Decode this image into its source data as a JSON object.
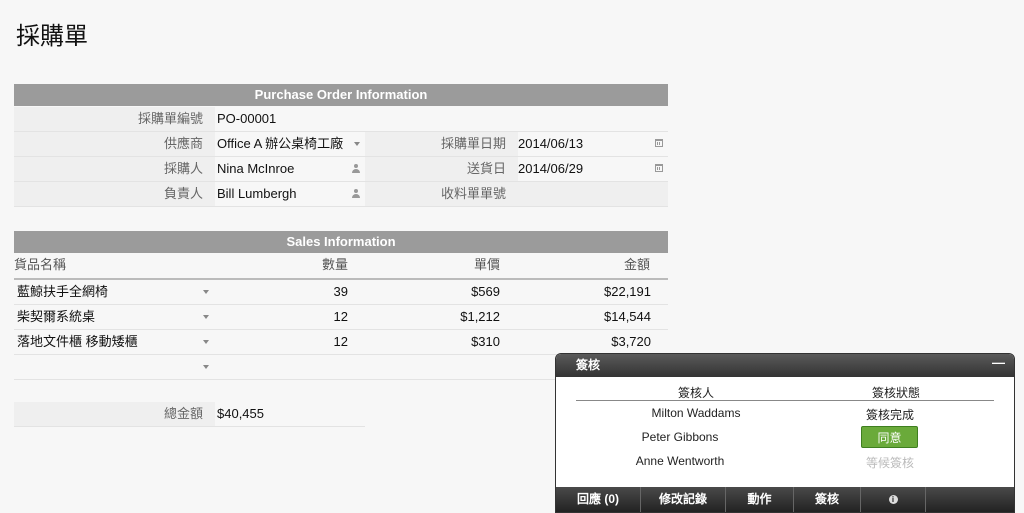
{
  "page": {
    "title": "採購單"
  },
  "purchase_order": {
    "header": "Purchase Order Information",
    "po_number_label": "採購單編號",
    "po_number": "PO-00001",
    "vendor_label": "供應商",
    "vendor": "Office A 辦公桌椅工廠",
    "order_date_label": "採購單日期",
    "order_date": "2014/06/13",
    "buyer_label": "採購人",
    "buyer": "Nina McInroe",
    "delivery_date_label": "送貨日",
    "delivery_date": "2014/06/29",
    "owner_label": "負責人",
    "owner": "Bill Lumbergh",
    "receipt_no_label": "收料單單號",
    "receipt_no": ""
  },
  "sales": {
    "header": "Sales Information",
    "columns": {
      "item": "貨品名稱",
      "qty": "數量",
      "price": "單價",
      "amount": "金額"
    },
    "rows": [
      {
        "item": "藍鯨扶手全網椅",
        "qty": "39",
        "price": "$569",
        "amount": "$22,191"
      },
      {
        "item": "柴契爾系統桌",
        "qty": "12",
        "price": "$1,212",
        "amount": "$14,544"
      },
      {
        "item": "落地文件櫃 移動矮櫃",
        "qty": "12",
        "price": "$310",
        "amount": "$3,720"
      }
    ],
    "total_label": "總金額",
    "total": "$40,455"
  },
  "approval": {
    "title": "簽核",
    "col_approver": "簽核人",
    "col_status": "簽核狀態",
    "rows": [
      {
        "approver": "Milton Waddams",
        "status": "簽核完成"
      },
      {
        "approver": "Peter Gibbons",
        "status": "同意"
      },
      {
        "approver": "Anne Wentworth",
        "status": "等候簽核"
      }
    ],
    "footer": {
      "reply": "回應 (0)",
      "history": "修改記錄",
      "action": "動作",
      "sign": "簽核",
      "info_glyph": "i"
    }
  },
  "colors": {
    "section_header": "#9b9b9b",
    "approve_button": "#6aaa3a",
    "pending_status": "#bbbbbb"
  }
}
